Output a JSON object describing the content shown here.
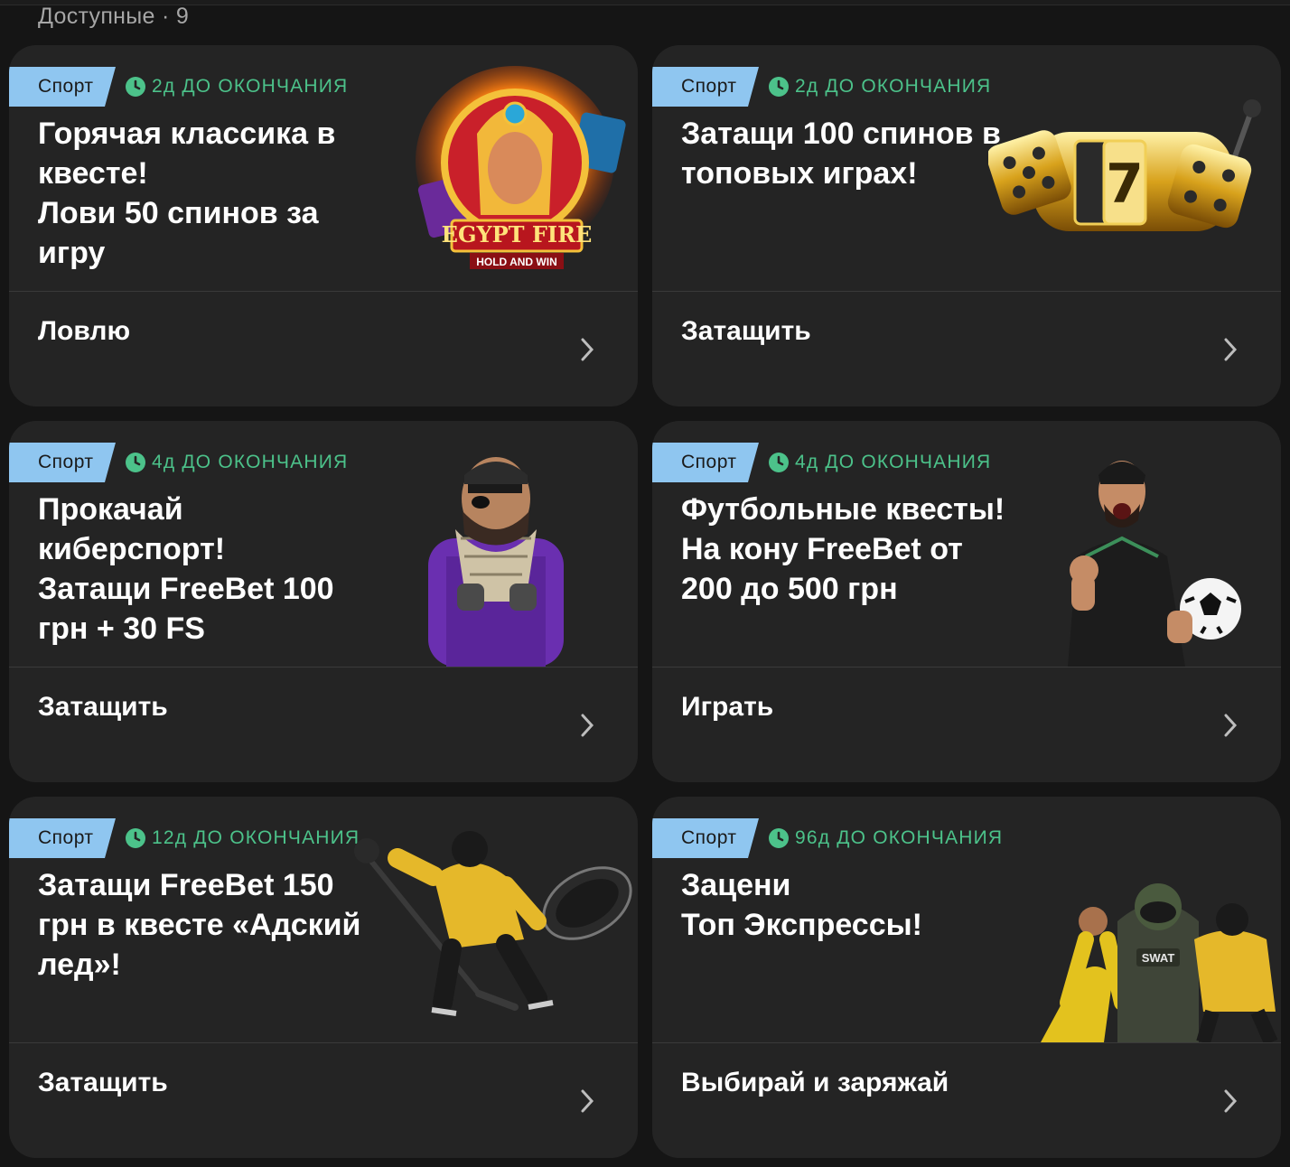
{
  "section": {
    "title": "Доступные · 9"
  },
  "cards": [
    {
      "tag": "Спорт",
      "timer": "2д ДО ОКОНЧАНИЯ",
      "title": "Горячая классика в\nквесте!\nЛови 50 спинов за\nигру",
      "action": "Ловлю",
      "art": {
        "kind": "slot-logo",
        "text_main": "EGYPT FIRE",
        "text_sub": "HOLD AND WIN"
      }
    },
    {
      "tag": "Спорт",
      "timer": "2д ДО ОКОНЧАНИЯ",
      "title": "Затащи 100 спинов в\nтоповых играх!",
      "action": "Затащить",
      "art": {
        "kind": "slot-machine"
      }
    },
    {
      "tag": "Спорт",
      "timer": "4д ДО ОКОНЧАНИЯ",
      "title": "Прокачай\nкиберспорт!\nЗатащи FreeBet 100\nгрн + 30 FS",
      "action": "Затащить",
      "art": {
        "kind": "esports-character"
      }
    },
    {
      "tag": "Спорт",
      "timer": "4д ДО ОКОНЧАНИЯ",
      "title": "Футбольные квесты!\nНа кону FreeBet от\n200 до 500 грн",
      "action": "Играть",
      "art": {
        "kind": "football-player"
      }
    },
    {
      "tag": "Спорт",
      "timer": "12д ДО ОКОНЧАНИЯ",
      "title": "Затащи FreeBet 150\nгрн в квесте «Адский\nлед»!",
      "action": "Затащить",
      "art": {
        "kind": "hockey-player"
      }
    },
    {
      "tag": "Спорт",
      "timer": "96д ДО ОКОНЧАНИЯ",
      "title": "Зацени\nТоп Экспрессы!",
      "action": "Выбирай и заряжай",
      "art": {
        "kind": "athletes-group",
        "badge": "SWAT"
      }
    }
  ],
  "colors": {
    "background": "#151515",
    "card": "#242424",
    "tag": "#8fc6f0",
    "timer": "#4cc28a",
    "divider": "#3a3a3a"
  },
  "icons": {
    "timer": "clock-icon",
    "chevron": "chevron-right-icon"
  }
}
